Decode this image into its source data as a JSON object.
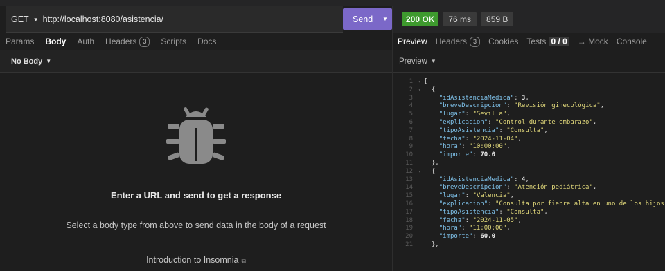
{
  "request": {
    "method": "GET",
    "url": "http://localhost:8080/asistencia/",
    "send_label": "Send"
  },
  "request_tabs": {
    "params": "Params",
    "body": "Body",
    "auth": "Auth",
    "headers": "Headers",
    "headers_count": "3",
    "scripts": "Scripts",
    "docs": "Docs"
  },
  "body_type": "No Body",
  "empty_state": {
    "title": "Enter a URL and send to get a response",
    "subtitle": "Select a body type from above to send data in the body of a request",
    "link": "Introduction to Insomnia"
  },
  "response": {
    "status": "200 OK",
    "time": "76 ms",
    "size": "859 B",
    "status_color": "#3e9a2e"
  },
  "response_tabs": {
    "preview": "Preview",
    "headers": "Headers",
    "headers_count": "3",
    "cookies": "Cookies",
    "tests": "Tests",
    "tests_value": "0 / 0",
    "mock": "→ Mock",
    "console": "Console"
  },
  "preview_mode": "Preview",
  "code_lines": [
    {
      "n": "1",
      "fold": true,
      "parts": [
        {
          "t": "p",
          "v": "["
        }
      ]
    },
    {
      "n": "2",
      "fold": true,
      "parts": [
        {
          "t": "p",
          "v": "  {"
        }
      ]
    },
    {
      "n": "3",
      "parts": [
        {
          "t": "p",
          "v": "    "
        },
        {
          "t": "k",
          "v": "\"idAsistenciaMedica\""
        },
        {
          "t": "p",
          "v": ": "
        },
        {
          "t": "n",
          "v": "3"
        },
        {
          "t": "p",
          "v": ","
        }
      ]
    },
    {
      "n": "4",
      "parts": [
        {
          "t": "p",
          "v": "    "
        },
        {
          "t": "k",
          "v": "\"breveDescripcion\""
        },
        {
          "t": "p",
          "v": ": "
        },
        {
          "t": "s",
          "v": "\"Revisión ginecológica\""
        },
        {
          "t": "p",
          "v": ","
        }
      ]
    },
    {
      "n": "5",
      "parts": [
        {
          "t": "p",
          "v": "    "
        },
        {
          "t": "k",
          "v": "\"lugar\""
        },
        {
          "t": "p",
          "v": ": "
        },
        {
          "t": "s",
          "v": "\"Sevilla\""
        },
        {
          "t": "p",
          "v": ","
        }
      ]
    },
    {
      "n": "6",
      "parts": [
        {
          "t": "p",
          "v": "    "
        },
        {
          "t": "k",
          "v": "\"explicacion\""
        },
        {
          "t": "p",
          "v": ": "
        },
        {
          "t": "s",
          "v": "\"Control durante embarazo\""
        },
        {
          "t": "p",
          "v": ","
        }
      ]
    },
    {
      "n": "7",
      "parts": [
        {
          "t": "p",
          "v": "    "
        },
        {
          "t": "k",
          "v": "\"tipoAsistencia\""
        },
        {
          "t": "p",
          "v": ": "
        },
        {
          "t": "s",
          "v": "\"Consulta\""
        },
        {
          "t": "p",
          "v": ","
        }
      ]
    },
    {
      "n": "8",
      "parts": [
        {
          "t": "p",
          "v": "    "
        },
        {
          "t": "k",
          "v": "\"fecha\""
        },
        {
          "t": "p",
          "v": ": "
        },
        {
          "t": "s",
          "v": "\"2024-11-04\""
        },
        {
          "t": "p",
          "v": ","
        }
      ]
    },
    {
      "n": "9",
      "parts": [
        {
          "t": "p",
          "v": "    "
        },
        {
          "t": "k",
          "v": "\"hora\""
        },
        {
          "t": "p",
          "v": ": "
        },
        {
          "t": "s",
          "v": "\"10:00:00\""
        },
        {
          "t": "p",
          "v": ","
        }
      ]
    },
    {
      "n": "10",
      "parts": [
        {
          "t": "p",
          "v": "    "
        },
        {
          "t": "k",
          "v": "\"importe\""
        },
        {
          "t": "p",
          "v": ": "
        },
        {
          "t": "n",
          "v": "70.0"
        }
      ]
    },
    {
      "n": "11",
      "parts": [
        {
          "t": "p",
          "v": "  },"
        }
      ]
    },
    {
      "n": "12",
      "fold": true,
      "parts": [
        {
          "t": "p",
          "v": "  {"
        }
      ]
    },
    {
      "n": "13",
      "parts": [
        {
          "t": "p",
          "v": "    "
        },
        {
          "t": "k",
          "v": "\"idAsistenciaMedica\""
        },
        {
          "t": "p",
          "v": ": "
        },
        {
          "t": "n",
          "v": "4"
        },
        {
          "t": "p",
          "v": ","
        }
      ]
    },
    {
      "n": "14",
      "parts": [
        {
          "t": "p",
          "v": "    "
        },
        {
          "t": "k",
          "v": "\"breveDescripcion\""
        },
        {
          "t": "p",
          "v": ": "
        },
        {
          "t": "s",
          "v": "\"Atención pediátrica\""
        },
        {
          "t": "p",
          "v": ","
        }
      ]
    },
    {
      "n": "15",
      "parts": [
        {
          "t": "p",
          "v": "    "
        },
        {
          "t": "k",
          "v": "\"lugar\""
        },
        {
          "t": "p",
          "v": ": "
        },
        {
          "t": "s",
          "v": "\"Valencia\""
        },
        {
          "t": "p",
          "v": ","
        }
      ]
    },
    {
      "n": "16",
      "parts": [
        {
          "t": "p",
          "v": "    "
        },
        {
          "t": "k",
          "v": "\"explicacion\""
        },
        {
          "t": "p",
          "v": ": "
        },
        {
          "t": "s",
          "v": "\"Consulta por fiebre alta en uno de los hijos\""
        },
        {
          "t": "p",
          "v": ","
        }
      ]
    },
    {
      "n": "17",
      "parts": [
        {
          "t": "p",
          "v": "    "
        },
        {
          "t": "k",
          "v": "\"tipoAsistencia\""
        },
        {
          "t": "p",
          "v": ": "
        },
        {
          "t": "s",
          "v": "\"Consulta\""
        },
        {
          "t": "p",
          "v": ","
        }
      ]
    },
    {
      "n": "18",
      "parts": [
        {
          "t": "p",
          "v": "    "
        },
        {
          "t": "k",
          "v": "\"fecha\""
        },
        {
          "t": "p",
          "v": ": "
        },
        {
          "t": "s",
          "v": "\"2024-11-05\""
        },
        {
          "t": "p",
          "v": ","
        }
      ]
    },
    {
      "n": "19",
      "parts": [
        {
          "t": "p",
          "v": "    "
        },
        {
          "t": "k",
          "v": "\"hora\""
        },
        {
          "t": "p",
          "v": ": "
        },
        {
          "t": "s",
          "v": "\"11:00:00\""
        },
        {
          "t": "p",
          "v": ","
        }
      ]
    },
    {
      "n": "20",
      "parts": [
        {
          "t": "p",
          "v": "    "
        },
        {
          "t": "k",
          "v": "\"importe\""
        },
        {
          "t": "p",
          "v": ": "
        },
        {
          "t": "n",
          "v": "60.0"
        }
      ]
    },
    {
      "n": "21",
      "parts": [
        {
          "t": "p",
          "v": "  },"
        }
      ]
    }
  ]
}
